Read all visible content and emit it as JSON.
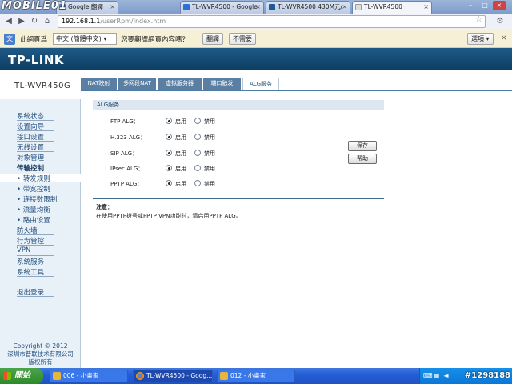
{
  "watermark_top": "MOBILE01",
  "browser": {
    "tabs": [
      {
        "label": "Google 翻譯"
      },
      {
        "label": "TL-WVR4500 - Google"
      },
      {
        "label": "TL-WVR4500 430M元/"
      },
      {
        "label": "TL-WVR4500"
      }
    ],
    "url_host": "192.168.1.1",
    "url_path": "/userRpm/Index.htm"
  },
  "translate_bar": {
    "prefix": "此網頁爲",
    "language": "中文 (簡體中文)",
    "question": "您要翻譯網頁內容嗎？",
    "translate_btn": "翻譯",
    "no_btn": "不需要",
    "options_btn": "選項"
  },
  "brand": "TP-LINK",
  "model": "TL-WVR450G",
  "top_tabs": [
    "NAT映射",
    "多网段NAT",
    "虚拟服务器",
    "端口触发",
    "ALG服务"
  ],
  "sidebar": {
    "items": [
      {
        "label": "系统状态"
      },
      {
        "label": "设置向导"
      },
      {
        "label": "接口设置"
      },
      {
        "label": "无线设置"
      },
      {
        "label": "对象管理"
      },
      {
        "label": "传输控制"
      },
      {
        "label": "• 转发规则"
      },
      {
        "label": "• 带宽控制"
      },
      {
        "label": "• 连接数限制"
      },
      {
        "label": "• 流量均衡"
      },
      {
        "label": "• 路由设置"
      },
      {
        "label": "防火墙"
      },
      {
        "label": "行为管控"
      },
      {
        "label": "VPN"
      },
      {
        "label": "系统服务"
      },
      {
        "label": "系统工具"
      },
      {
        "label": "退出登录"
      }
    ],
    "copyright_line1": "Copyright © 2012",
    "copyright_line2": "深圳市普联技术有限公司",
    "copyright_line3": "版权所有"
  },
  "main": {
    "section_title": "ALG服务",
    "rows": [
      {
        "label": "FTP ALG：",
        "enabled": true
      },
      {
        "label": "H.323 ALG：",
        "enabled": true
      },
      {
        "label": "SIP ALG：",
        "enabled": true
      },
      {
        "label": "IPsec ALG：",
        "enabled": true
      },
      {
        "label": "PPTP ALG：",
        "enabled": true
      }
    ],
    "on_label": "启用",
    "off_label": "禁用",
    "save_btn": "保存",
    "help_btn": "帮助",
    "note_title": "注意：",
    "note_text": "在使用PPTP拨号或PPTP VPN功能时，请启用PPTP ALG。"
  },
  "taskbar": {
    "start": "開始",
    "items": [
      {
        "label": "006 - 小畫家"
      },
      {
        "label": "TL-WVR4500 - Goog..."
      },
      {
        "label": "012 - 小畫家"
      }
    ],
    "image_id": "#1298188"
  }
}
